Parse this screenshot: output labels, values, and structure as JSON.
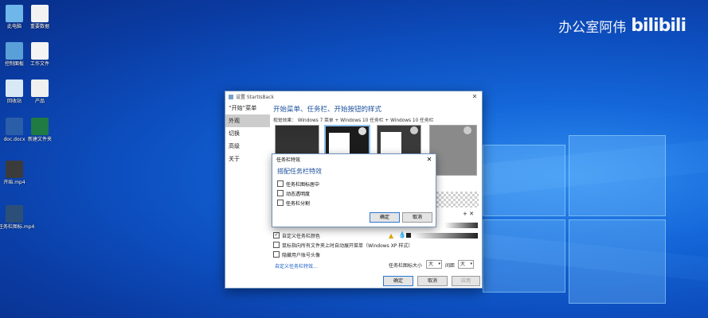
{
  "desktop": {
    "icons": [
      {
        "label": "此电脑",
        "icon": "computer-icon",
        "color": "#6fb6ea"
      },
      {
        "label": "重要数据",
        "icon": "document-icon",
        "color": "#f2f2f2"
      },
      {
        "label": "控制面板",
        "icon": "control-panel-icon",
        "color": "#5aa0d8"
      },
      {
        "label": "工作文件",
        "icon": "document-icon",
        "color": "#f4f4f4"
      },
      {
        "label": "回收站",
        "icon": "recycle-bin-icon",
        "color": "#d9e8f5"
      },
      {
        "label": "产品",
        "icon": "audio-file-icon",
        "color": "#f0f0f0"
      },
      {
        "label": "doc.docx",
        "icon": "word-icon",
        "color": "#2b5ea8"
      },
      {
        "label": "新建文件夹",
        "icon": "excel-icon",
        "color": "#1f7a43"
      },
      {
        "label": "开始.mp4",
        "icon": "video-icon",
        "color": "#3b3b3b"
      },
      {
        "label": "任务栏图标.mp4",
        "icon": "video-icon",
        "color": "#2c4f7a"
      }
    ]
  },
  "watermark": {
    "text": "办公室阿伟",
    "logo": "bilibili"
  },
  "main_window": {
    "title": "设置 StartIsBack",
    "sidebar": [
      "“开始”菜单",
      "外观",
      "切换",
      "高级",
      "关于"
    ],
    "selected": 1,
    "heading": "开始菜单、任务栏、开始按钮的样式",
    "visual_label": "视觉效果：",
    "visual_options": "Windows 7 菜单 + Windows 10 任务栏 + Windows 10 任务栏",
    "checkboxes": [
      {
        "label": "自定义任务栏颜色",
        "checked": true
      },
      {
        "label": "鼠标指向所有文件夹上时自动展开菜单（Windows XP 样式）",
        "checked": false
      },
      {
        "label": "隐藏用户账号头像",
        "checked": false
      }
    ],
    "icon_size_label": "任务栏图标大小",
    "icon_size_value": "大",
    "spacing_label": "间距",
    "spacing_value": "大",
    "link": "自定义任务栏特效...",
    "buttons": {
      "ok": "确定",
      "cancel": "取消",
      "apply": "应用"
    },
    "colors": {
      "accent": "#1a4f9c",
      "link": "#1a5fc8"
    }
  },
  "dialog": {
    "title": "任务栏特效",
    "heading": "搭配任务栏特效",
    "options": [
      {
        "label": "任务栏图标居中",
        "checked": false
      },
      {
        "label": "动态透明度",
        "checked": false
      },
      {
        "label": "任务栏分割",
        "checked": false
      }
    ],
    "buttons": {
      "ok": "确定",
      "cancel": "取消"
    }
  }
}
